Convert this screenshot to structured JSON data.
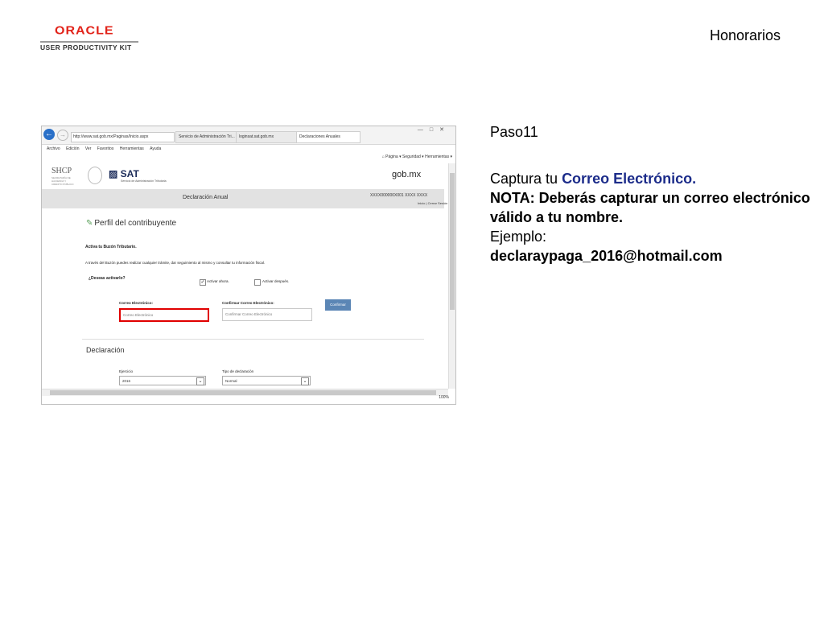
{
  "header": {
    "logo_word": "ORACLE",
    "logo_sub": "USER PRODUCTIVITY KIT",
    "title": "Honorarios"
  },
  "browser": {
    "address": "http://www.sat.gob.mx/Paginas/Inicio.aspx",
    "tabs": [
      "Servicio de Administración Tri...",
      "loginsat.sat.gob.mx",
      "Declaraciones Anuales"
    ],
    "active_tab": 2,
    "menu": [
      "Archivo",
      "Edición",
      "Ver",
      "Favoritos",
      "Herramientas",
      "Ayuda"
    ],
    "commandbar": [
      "Página ▾",
      "Seguridad ▾",
      "Herramientas ▾"
    ],
    "zoom": "100%"
  },
  "site": {
    "shcp": "SHCP",
    "shcp_sub": "SECRETARÍA DE HACIENDA Y CRÉDITO PÚBLICO",
    "sat": "SAT",
    "sat_sub": "Servicio de Administración Tributaria",
    "gobmx": "gob.mx",
    "page_title": "Declaración Anual",
    "rfc": "XXXX000000X001  XXXX XXXX",
    "inicio": "Inicio | Cerrar Sesión"
  },
  "form": {
    "section_title": "Perfil del contribuyente",
    "activa": "Activa tu Buzón Tributario.",
    "desc": "A través del Buzón puedes realizar cualquier trámite, dar seguimiento al mismo y consultar tu información fiscal.",
    "deseas": "¿Deseas activarlo?",
    "activar_ahora": "Activar ahora.",
    "activar_despues": "Activar después.",
    "correo_label": "Correo Electrónico:",
    "correo_placeholder": "Correo Electrónico",
    "confirmar_label": "Confirmar Correo Electrónico:",
    "confirmar_placeholder": "Confirmar Correo Electrónico",
    "confirmar_btn": "Confirmar",
    "declaracion_title": "Declaración",
    "ejercicio_label": "Ejercicio",
    "ejercicio_value": "2016",
    "tipo_label": "Tipo de declaración",
    "tipo_value": "Normal"
  },
  "instructions": {
    "step": "Paso11",
    "line1_prefix": "Captura tu ",
    "line1_highlight": "Correo Electrónico.",
    "line2": "NOTA: Deberás capturar un correo electrónico válido a tu nombre.",
    "line3": "Ejemplo:",
    "line4": "declaraypaga_2016@hotmail.com"
  },
  "colors": {
    "oracle_red": "#e2231a",
    "highlight_blue": "#1c2c8a",
    "callout_red": "#e00000"
  }
}
